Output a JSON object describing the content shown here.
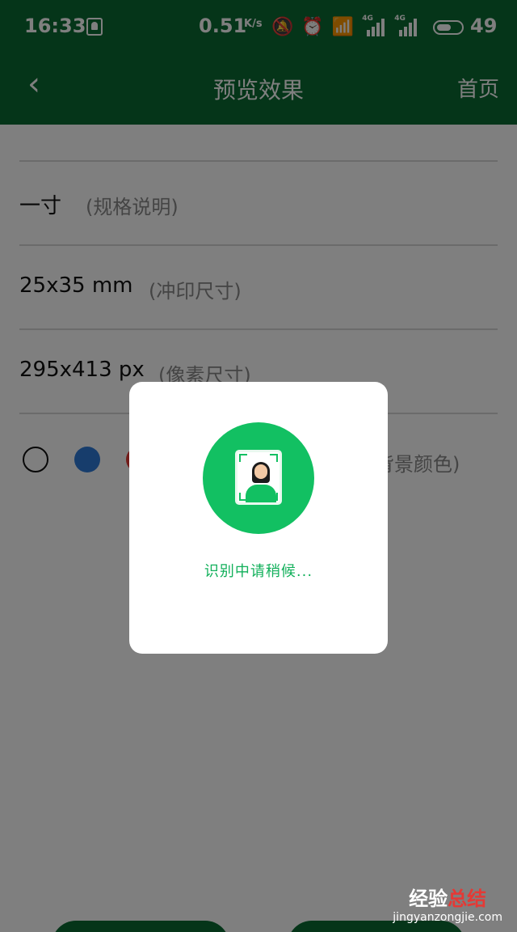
{
  "status_bar": {
    "time": "16:33",
    "speed": "0.51",
    "speed_unit": "K/s",
    "battery": "49",
    "network": "4G"
  },
  "app_bar": {
    "title": "预览效果",
    "home": "首页",
    "back_icon": "chevron-left-icon"
  },
  "spec": {
    "name": "一寸",
    "name_hint": "(规格说明)",
    "print_size": "25x35 mm",
    "print_hint": "(冲印尺寸)",
    "pixel_size": "295x413 px",
    "pixel_hint": "(像素尺寸)"
  },
  "background": {
    "hint": "背景颜色)",
    "colors": [
      "#ffffff",
      "#2f7ad8",
      "#e53935"
    ]
  },
  "dialog": {
    "message": "识别中请稍候...",
    "icon": "id-photo-icon"
  },
  "watermark": {
    "main_a": "经验",
    "main_b": "总结",
    "sub": "jingyanzongjie.com"
  }
}
